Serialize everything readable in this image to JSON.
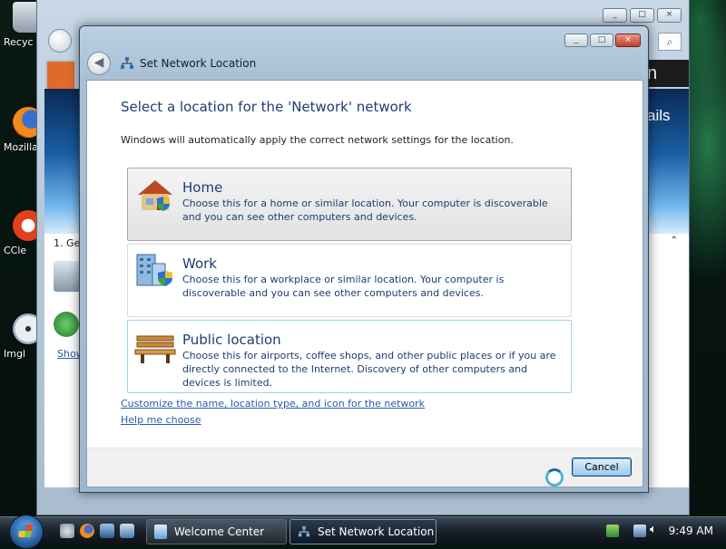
{
  "desktop": {
    "icons": [
      {
        "label": "Recyc",
        "icon": "recycle-bin-icon"
      },
      {
        "label": "Mozilla",
        "icon": "firefox-icon"
      },
      {
        "label": "CCle",
        "icon": "ccleaner-icon"
      },
      {
        "label": "Imgl",
        "icon": "imgburn-icon"
      }
    ]
  },
  "background_window": {
    "name": "Welcome Center",
    "title_fragment": "n",
    "details_fragment": "ails",
    "step_text": "1. Ge",
    "show_link": "Show",
    "chevron": "^",
    "search_icon": "search-icon"
  },
  "dialog": {
    "title": "Set Network Location",
    "buttons": {
      "minimize": "_",
      "maximize": "□",
      "close": "×"
    },
    "heading": "Select a location for the 'Network' network",
    "description": "Windows will automatically apply the correct network settings for the location.",
    "options": [
      {
        "title": "Home",
        "description": "Choose this for a home or similar location. Your computer is discoverable and you can see other computers and devices.",
        "icon": "home-icon",
        "state": "selected"
      },
      {
        "title": "Work",
        "description": "Choose this for a workplace or similar location. Your computer is discoverable and you can see other computers and devices.",
        "icon": "office-building-icon",
        "state": "normal"
      },
      {
        "title": "Public location",
        "description": "Choose this for airports, coffee shops, and other public places or if you are directly connected to the Internet. Discovery of other computers and devices is limited.",
        "icon": "park-bench-icon",
        "state": "focused"
      }
    ],
    "links": {
      "customize": "Customize the name, location type, and icon for the network",
      "help": "Help me choose"
    },
    "cancel_label": "Cancel"
  },
  "taskbar": {
    "tasks": [
      {
        "label": "Welcome Center",
        "active": false
      },
      {
        "label": "Set Network Location",
        "active": true
      }
    ],
    "clock": "9:49 AM"
  },
  "colors": {
    "heading": "#1e3d73",
    "link": "#2a5ba8",
    "selected_option": "#e2e2e2"
  }
}
